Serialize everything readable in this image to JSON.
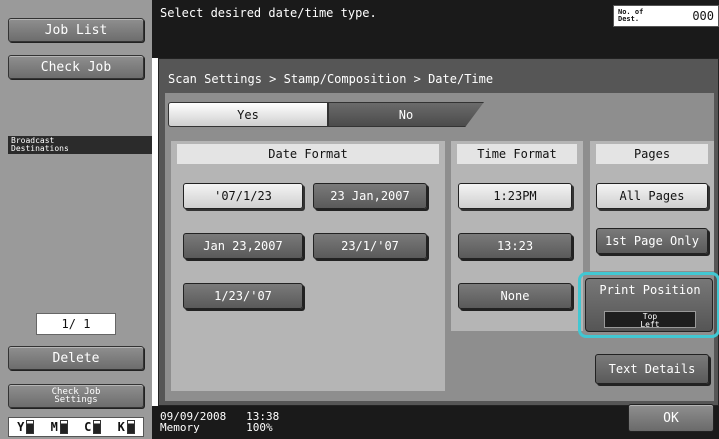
{
  "sidebar": {
    "job_list": "Job List",
    "check_job": "Check Job",
    "broadcast": "Broadcast\nDestinations",
    "page_count": "1/ 1",
    "delete": "Delete",
    "check_job_settings": "Check Job\nSettings",
    "toner": [
      {
        "color": "Y",
        "level": 0.8
      },
      {
        "color": "M",
        "level": 0.8
      },
      {
        "color": "C",
        "level": 0.8
      },
      {
        "color": "K",
        "level": 0.8
      }
    ]
  },
  "header": {
    "message": "Select desired date/time type.",
    "dest_label": "No. of\nDest.",
    "dest_value": "000"
  },
  "panel": {
    "breadcrumb": "Scan Settings > Stamp/Composition > Date/Time",
    "yes": "Yes",
    "no": "No",
    "no_selected": true
  },
  "date_format": {
    "title": "Date Format",
    "options": [
      {
        "label": "'07/1/23",
        "selected": true
      },
      {
        "label": "23 Jan,2007",
        "selected": false
      },
      {
        "label": "Jan 23,2007",
        "selected": false
      },
      {
        "label": "23/1/'07",
        "selected": false
      },
      {
        "label": "1/23/'07",
        "selected": false
      }
    ]
  },
  "time_format": {
    "title": "Time Format",
    "options": [
      {
        "label": "1:23PM",
        "selected": true
      },
      {
        "label": "13:23",
        "selected": false
      },
      {
        "label": "None",
        "selected": false
      }
    ]
  },
  "pages": {
    "title": "Pages",
    "all_pages": "All Pages",
    "first_page": "1st Page Only",
    "print_position": "Print Position",
    "print_position_value": "Top\nLeft",
    "text_details": "Text Details"
  },
  "footer": {
    "datetime": "09/09/2008   13:38\nMemory       100%",
    "ok": "OK"
  }
}
